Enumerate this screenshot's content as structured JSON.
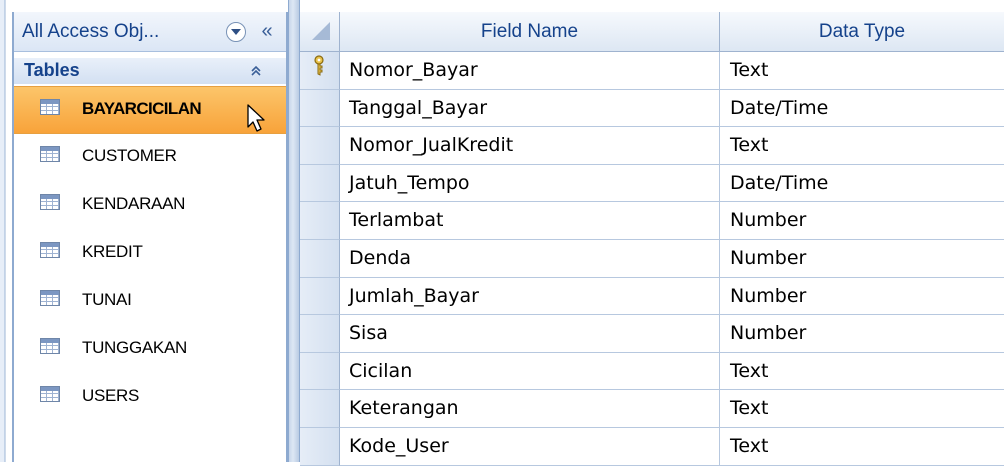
{
  "nav_pane": {
    "title": "All Access Obj...",
    "collapse_glyph": "«",
    "group": {
      "title": "Tables",
      "toggle_glyph": "⌃⌃"
    },
    "items": [
      {
        "label": "BAYARCICILAN",
        "icon": "table-icon",
        "selected": true
      },
      {
        "label": "CUSTOMER",
        "icon": "table-icon",
        "selected": false
      },
      {
        "label": "KENDARAAN",
        "icon": "table-icon",
        "selected": false
      },
      {
        "label": "KREDIT",
        "icon": "table-icon",
        "selected": false
      },
      {
        "label": "TUNAI",
        "icon": "table-icon",
        "selected": false
      },
      {
        "label": "TUNGGAKAN",
        "icon": "table-icon",
        "selected": false
      },
      {
        "label": "USERS",
        "icon": "table-icon",
        "selected": false
      }
    ]
  },
  "design_grid": {
    "columns": {
      "field_name": "Field Name",
      "data_type": "Data Type"
    },
    "rows": [
      {
        "field": "Nomor_Bayar",
        "type": "Text",
        "primary_key": true
      },
      {
        "field": "Tanggal_Bayar",
        "type": "Date/Time"
      },
      {
        "field": "Nomor_JualKredit",
        "type": "Text"
      },
      {
        "field": "Jatuh_Tempo",
        "type": "Date/Time"
      },
      {
        "field": "Terlambat",
        "type": "Number"
      },
      {
        "field": "Denda",
        "type": "Number"
      },
      {
        "field": "Jumlah_Bayar",
        "type": "Number"
      },
      {
        "field": "Sisa",
        "type": "Number"
      },
      {
        "field": "Cicilan",
        "type": "Text"
      },
      {
        "field": "Keterangan",
        "type": "Text"
      },
      {
        "field": "Kode_User",
        "type": "Text"
      }
    ]
  },
  "colors": {
    "header_text": "#15428b",
    "selected_item": "#f8a33a",
    "border": "#8eaad0"
  }
}
